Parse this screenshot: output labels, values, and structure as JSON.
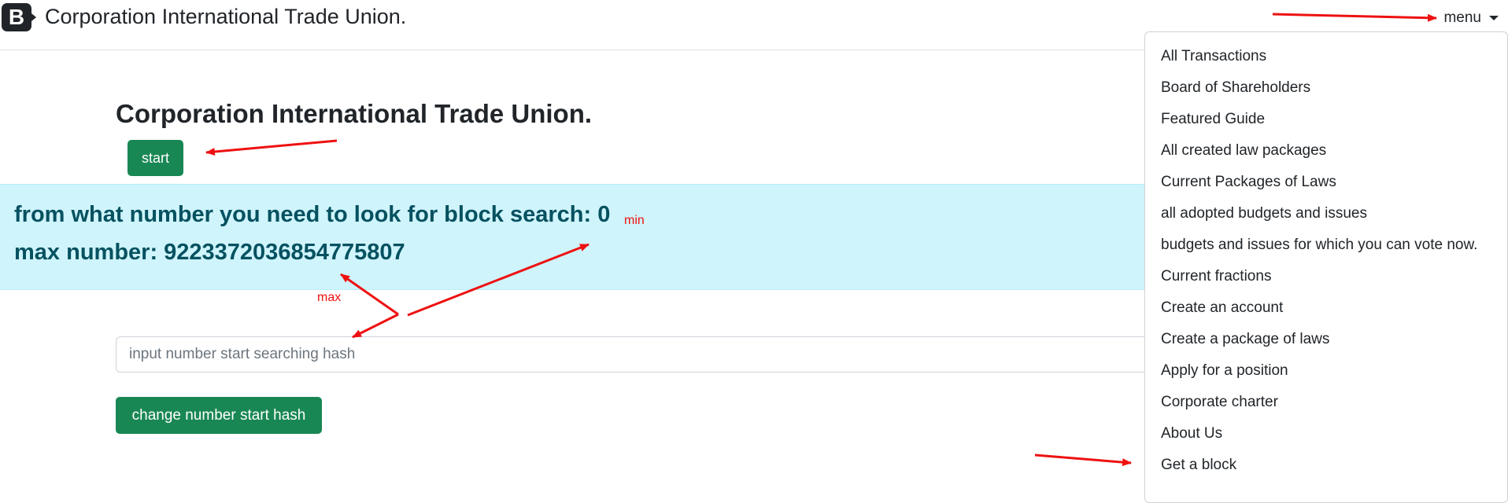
{
  "navbar": {
    "logo_letter": "B",
    "brand": "Corporation International Trade Union.",
    "menu_label": "menu"
  },
  "main": {
    "title": "Corporation International Trade Union.",
    "start_button": "start",
    "alert": {
      "line1": "from what number you need to look for block search: 0",
      "line2": "max number: 9223372036854775807"
    },
    "input_placeholder": "input number start searching hash",
    "change_button": "change number start hash"
  },
  "annotations": {
    "min_label": "min",
    "max_label": "max"
  },
  "dropdown": {
    "items": [
      "All Transactions",
      "Board of Shareholders",
      "Featured Guide",
      "All created law packages",
      "Current Packages of Laws",
      "all adopted budgets and issues",
      "budgets and issues for which you can vote now.",
      "Current fractions",
      "Create an account",
      "Create a package of laws",
      "Apply for a position",
      "Corporate charter",
      "About Us",
      "Get a block"
    ]
  },
  "colors": {
    "success": "#198754",
    "alert_bg": "#cff4fc",
    "alert_text": "#055160",
    "annotation": "#ee1111"
  }
}
